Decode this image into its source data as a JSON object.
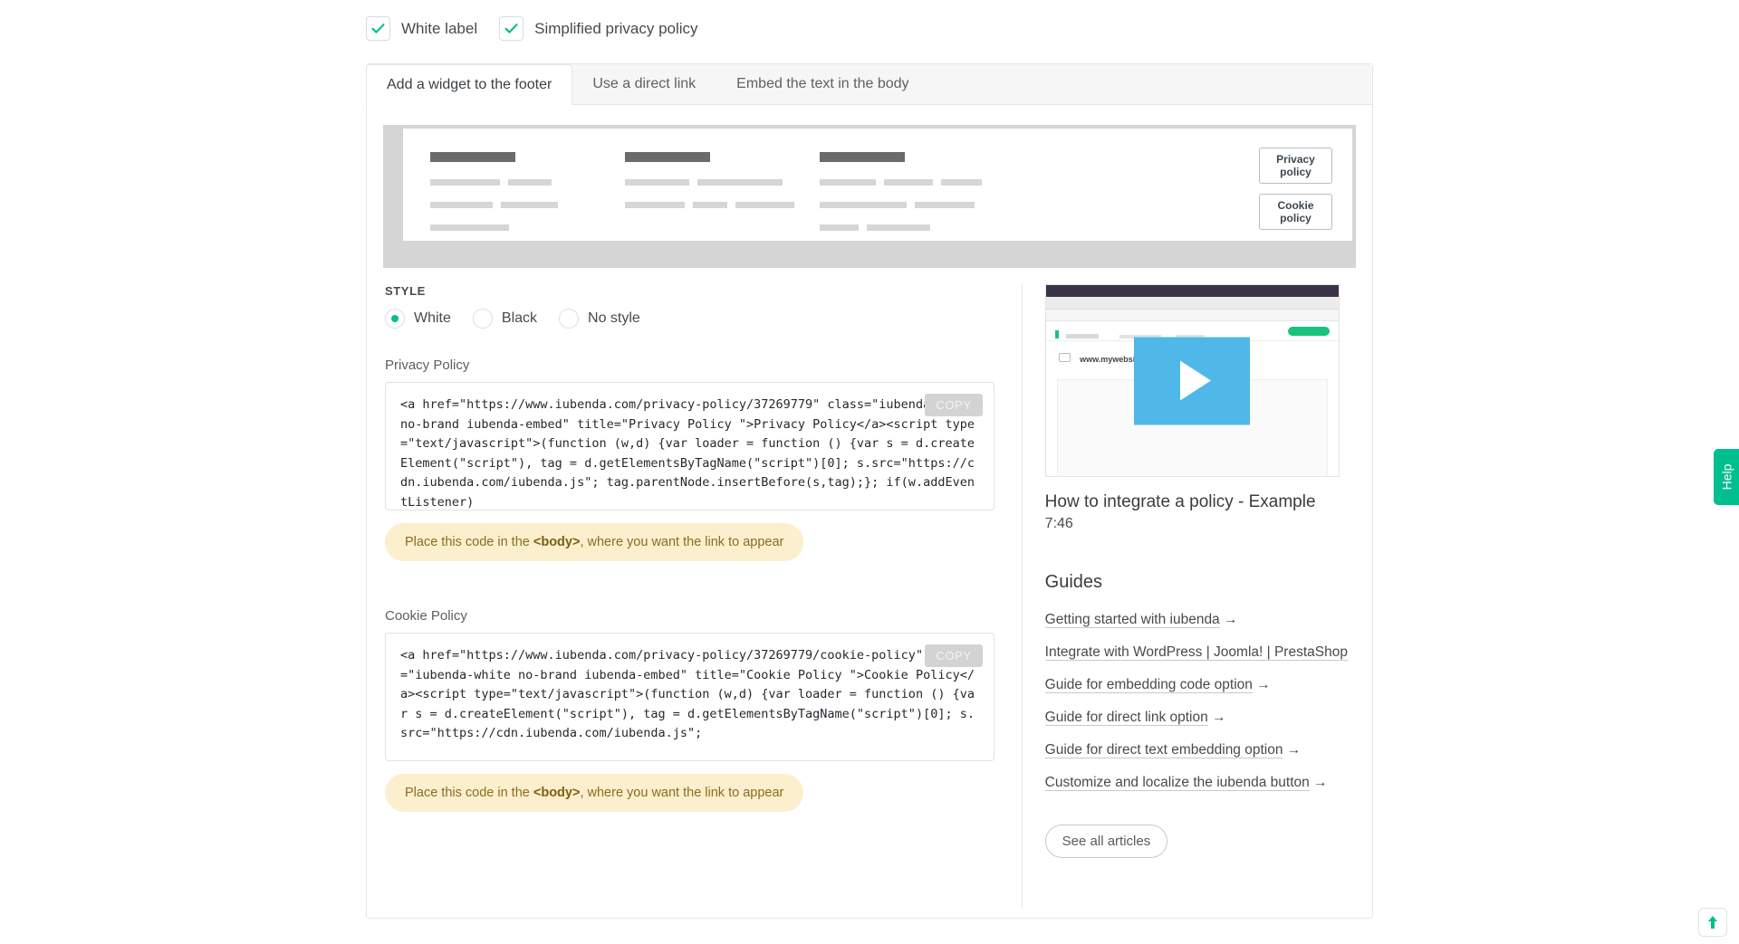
{
  "checkboxes": [
    {
      "label": "White label",
      "checked": true,
      "icon": "check-icon"
    },
    {
      "label": "Simplified privacy policy",
      "checked": true,
      "icon": "check-icon"
    }
  ],
  "tabs": [
    {
      "label": "Add a widget to the footer",
      "active": true
    },
    {
      "label": "Use a direct link",
      "active": false
    },
    {
      "label": "Embed the text in the body",
      "active": false
    }
  ],
  "preview": {
    "privacy_button": "Privacy policy",
    "cookie_button": "Cookie policy"
  },
  "style": {
    "heading": "STYLE",
    "options": [
      {
        "label": "White",
        "selected": true
      },
      {
        "label": "Black",
        "selected": false
      },
      {
        "label": "No style",
        "selected": false
      }
    ],
    "accent_color": "#00c08b"
  },
  "privacy": {
    "label": "Privacy Policy",
    "copy_label": "COPY",
    "code": "<a href=\"https://www.iubenda.com/privacy-policy/37269779\" class=\"iubenda-white no-brand iubenda-embed\" title=\"Privacy Policy \">Privacy Policy</a><script type=\"text/javascript\">(function (w,d) {var loader = function () {var s = d.createElement(\"script\"), tag = d.getElementsByTagName(\"script\")[0]; s.src=\"https://cdn.iubenda.com/iubenda.js\"; tag.parentNode.insertBefore(s,tag);}; if(w.addEventListener)",
    "notice_prefix": "Place this code in the ",
    "notice_code": "<body>",
    "notice_suffix": ", where you want the link to appear"
  },
  "cookie": {
    "label": "Cookie Policy",
    "copy_label": "COPY",
    "code": "<a href=\"https://www.iubenda.com/privacy-policy/37269779/cookie-policy\" class=\"iubenda-white no-brand iubenda-embed\" title=\"Cookie Policy \">Cookie Policy</a><script type=\"text/javascript\">(function (w,d) {var loader = function () {var s = d.createElement(\"script\"), tag = d.getElementsByTagName(\"script\")[0]; s.src=\"https://cdn.iubenda.com/iubenda.js\";",
    "notice_prefix": "Place this code in the ",
    "notice_code": "<body>",
    "notice_suffix": ", where you want the link to appear"
  },
  "sidebar": {
    "video": {
      "title": "How to integrate a policy - Example",
      "duration": "7:46",
      "play_icon": "play-icon"
    },
    "guides_heading": "Guides",
    "guides": [
      {
        "text": "Getting started with iubenda",
        "arrow": "→"
      },
      {
        "text": "Integrate with WordPress | Joomla! | PrestaShop",
        "arrow": ""
      },
      {
        "text": "Guide for embedding code option",
        "arrow": "→"
      },
      {
        "text": "Guide for direct link option",
        "arrow": "→"
      },
      {
        "text": "Guide for direct text embedding option",
        "arrow": "→"
      },
      {
        "text": "Customize and localize the iubenda button",
        "arrow": "→"
      }
    ],
    "see_all_label": "See all articles"
  },
  "floating": {
    "help_label": "Help",
    "scroll_top_icon": "arrow-up-icon",
    "help_color": "#00bf8f"
  }
}
